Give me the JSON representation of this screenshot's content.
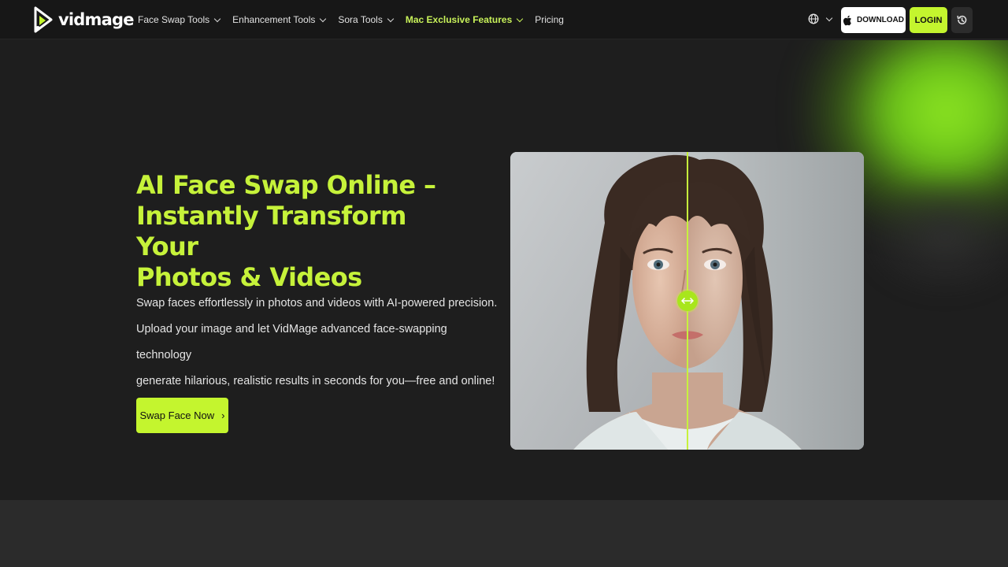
{
  "brand": {
    "name": "vidmage",
    "accent": "#c4f52e",
    "background": "#1e1e1e"
  },
  "nav": {
    "items": [
      {
        "label": "Face Swap Tools",
        "dropdown": true
      },
      {
        "label": "Enhancement Tools",
        "dropdown": true
      },
      {
        "label": "Sora Tools",
        "dropdown": true
      },
      {
        "label": "Mac Exclusive Features",
        "dropdown": true,
        "highlighted": true
      },
      {
        "label": "Pricing",
        "dropdown": false
      }
    ],
    "language_icon": "globe-icon",
    "download_label": "DOWNLOAD",
    "download_icon": "apple-icon",
    "login_label": "LOGIN",
    "history_icon": "history-icon"
  },
  "hero": {
    "title_lines": [
      "AI Face Swap Online –",
      "Instantly Transform Your",
      "Photos & Videos"
    ],
    "description_lines": [
      "Swap faces effortlessly in photos and videos with AI-powered precision.",
      "Upload your image and let VidMage advanced face-swapping technology",
      "generate hilarious, realistic results in seconds for you—free and online!"
    ],
    "cta_label": "Swap Face Now",
    "cta_arrow": "›",
    "compare_handle_icon": "swap-arrows-icon"
  }
}
